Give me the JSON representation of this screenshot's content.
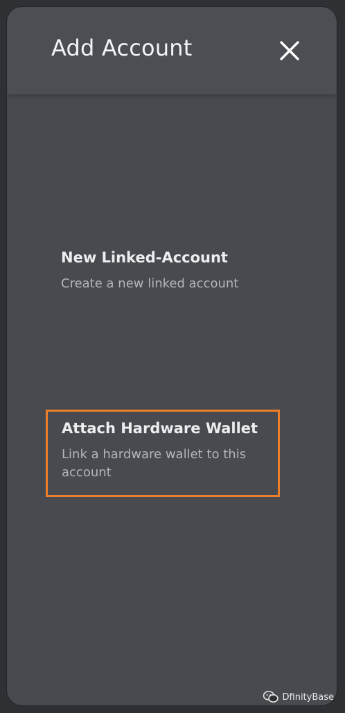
{
  "modal": {
    "title": "Add Account",
    "close_icon": "close-icon"
  },
  "options": [
    {
      "title": "New Linked-Account",
      "description": "Create a new linked account"
    },
    {
      "title": "Attach Hardware Wallet",
      "description": "Link a hardware wallet to this account",
      "highlighted": true,
      "highlight_color": "#ee7f2a"
    }
  ],
  "watermark": {
    "icon": "wechat-icon",
    "text": "DfinityBase"
  },
  "colors": {
    "background": "#2f3034",
    "panel": "#494a4f",
    "title_text": "#f3f4f6",
    "description_text": "#b2b5ba"
  }
}
